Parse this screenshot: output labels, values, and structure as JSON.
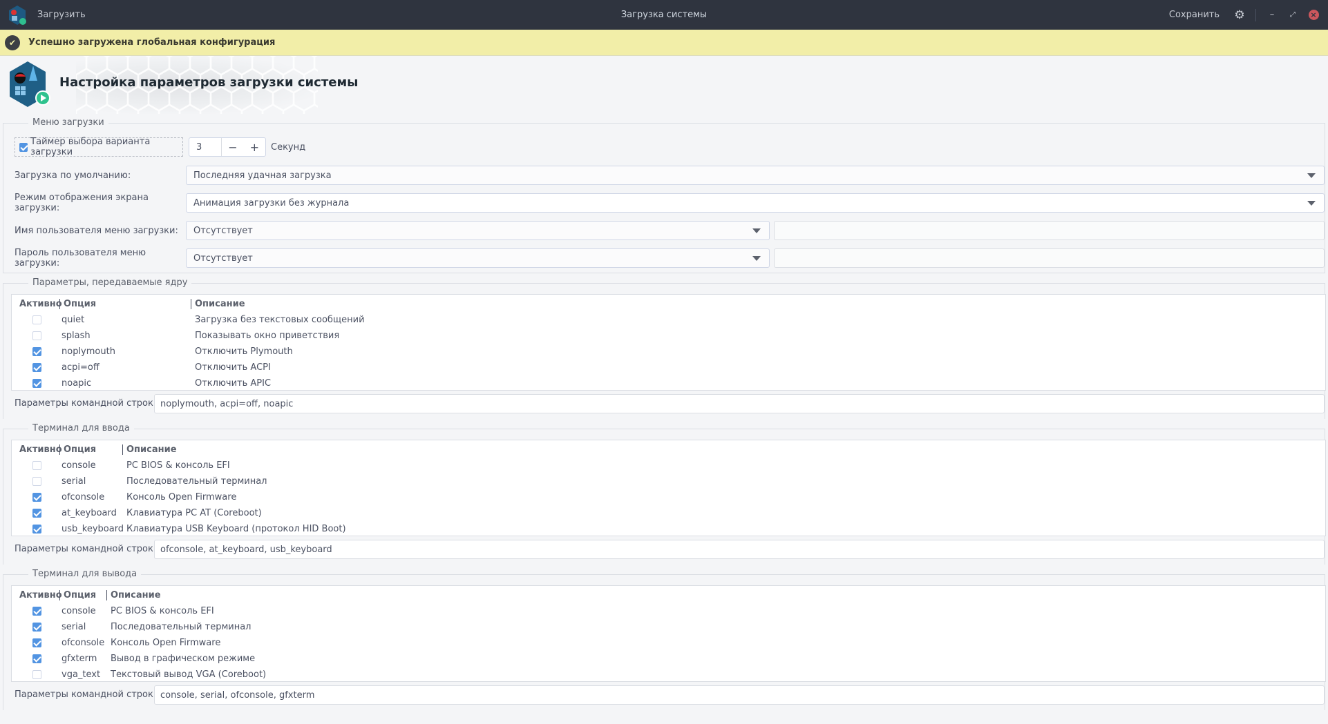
{
  "titlebar": {
    "load_label": "Загрузить",
    "title": "Загрузка системы",
    "save_label": "Сохранить"
  },
  "banner": {
    "message": "Успешно загружена глобальная конфигурация",
    "icon": "check-circle-icon"
  },
  "header": {
    "title": "Настройка параметров загрузки системы"
  },
  "boot_menu": {
    "label": "Меню загрузки",
    "timer": {
      "label": "Таймер выбора варианта загрузки",
      "checked": true,
      "value": "3",
      "minus": "−",
      "plus": "+",
      "unit": "Секунд"
    },
    "default_boot": {
      "label": "Загрузка по умолчанию:",
      "value": "Последняя удачная загрузка"
    },
    "display_mode": {
      "label": "Режим отображения экрана загрузки:",
      "value": "Анимация загрузки без журнала"
    },
    "username": {
      "label": "Имя пользователя меню загрузки:",
      "value": "Отсутствует",
      "text": ""
    },
    "password": {
      "label": "Пароль пользователя меню загрузки:",
      "value": "Отсутствует",
      "text": ""
    }
  },
  "kernel": {
    "label": "Параметры, передаваемые ядру",
    "headers": [
      "Активно",
      "Опция",
      "Описание"
    ],
    "rows": [
      {
        "checked": false,
        "option": "quiet",
        "desc": "Загрузка без текстовых сообщений"
      },
      {
        "checked": false,
        "option": "splash",
        "desc": "Показывать окно приветствия"
      },
      {
        "checked": true,
        "option": "noplymouth",
        "desc": "Отключить Plymouth"
      },
      {
        "checked": true,
        "option": "acpi=off",
        "desc": "Отключить ACPI"
      },
      {
        "checked": true,
        "option": "noapic",
        "desc": "Отключить APIC"
      }
    ],
    "cmd_label": "Параметры командной строки:",
    "cmd_value": "noplymouth, acpi=off, noapic"
  },
  "input_term": {
    "label": "Терминал для ввода",
    "headers": [
      "Активно",
      "Опция",
      "Описание"
    ],
    "rows": [
      {
        "checked": false,
        "option": "console",
        "desc": "PC BIOS & консоль EFI"
      },
      {
        "checked": false,
        "option": "serial",
        "desc": "Последовательный терминал"
      },
      {
        "checked": true,
        "option": "ofconsole",
        "desc": "Консоль Open Firmware"
      },
      {
        "checked": true,
        "option": "at_keyboard",
        "desc": "Клавиатура PC AT (Coreboot)"
      },
      {
        "checked": true,
        "option": "usb_keyboard",
        "desc": "Клавиатура USB Keyboard (протокол HID Boot)"
      }
    ],
    "cmd_label": "Параметры командной строки:",
    "cmd_value": "ofconsole, at_keyboard, usb_keyboard"
  },
  "output_term": {
    "label": "Терминал для вывода",
    "headers": [
      "Активно",
      "Опция",
      "Описание"
    ],
    "rows": [
      {
        "checked": true,
        "option": "console",
        "desc": "PC BIOS & консоль EFI"
      },
      {
        "checked": true,
        "option": "serial",
        "desc": "Последовательный терминал"
      },
      {
        "checked": true,
        "option": "ofconsole",
        "desc": "Консоль Open Firmware"
      },
      {
        "checked": true,
        "option": "gfxterm",
        "desc": "Вывод в графическом режиме"
      },
      {
        "checked": false,
        "option": "vga_text",
        "desc": "Текстовый вывод VGA (Coreboot)"
      }
    ],
    "cmd_label": "Параметры командной строки:",
    "cmd_value": "console, serial, ofconsole, gfxterm"
  },
  "colors": {
    "titlebar": "#2f343f",
    "banner": "#f2eea8",
    "accent": "#5294e2",
    "close": "#cc575d"
  }
}
